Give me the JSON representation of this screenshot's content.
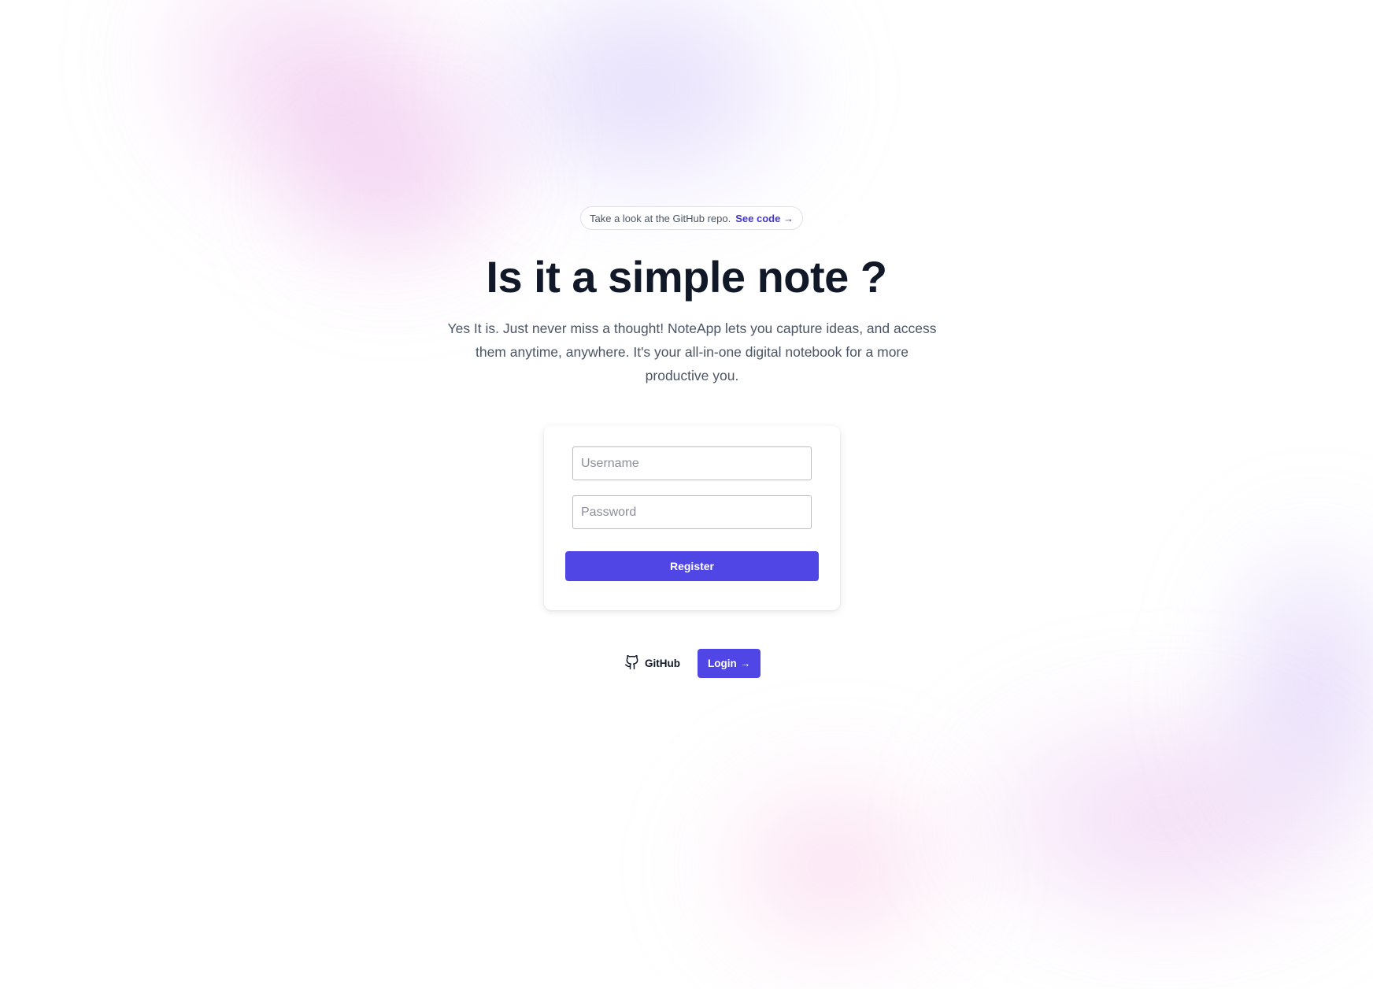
{
  "banner": {
    "text": "Take a look at the GitHub repo.",
    "link_label": "See code",
    "link_arrow": "→"
  },
  "hero": {
    "title": "Is it a simple note ?",
    "subtitle": "Yes It is. Just never miss a thought! NoteApp lets you capture ideas, and access them anytime, anywhere. It's your all-in-one digital notebook for a more productive you."
  },
  "form": {
    "username_placeholder": "Username",
    "password_placeholder": "Password",
    "username_value": "",
    "password_value": "",
    "submit_label": "Register"
  },
  "footer_actions": {
    "github_label": "GitHub",
    "github_icon": "github-icon",
    "login_label": "Login",
    "login_arrow": "→"
  },
  "colors": {
    "accent": "#4f46e5",
    "link": "#4338ca",
    "heading": "#111827",
    "body_text": "#4b5563"
  }
}
